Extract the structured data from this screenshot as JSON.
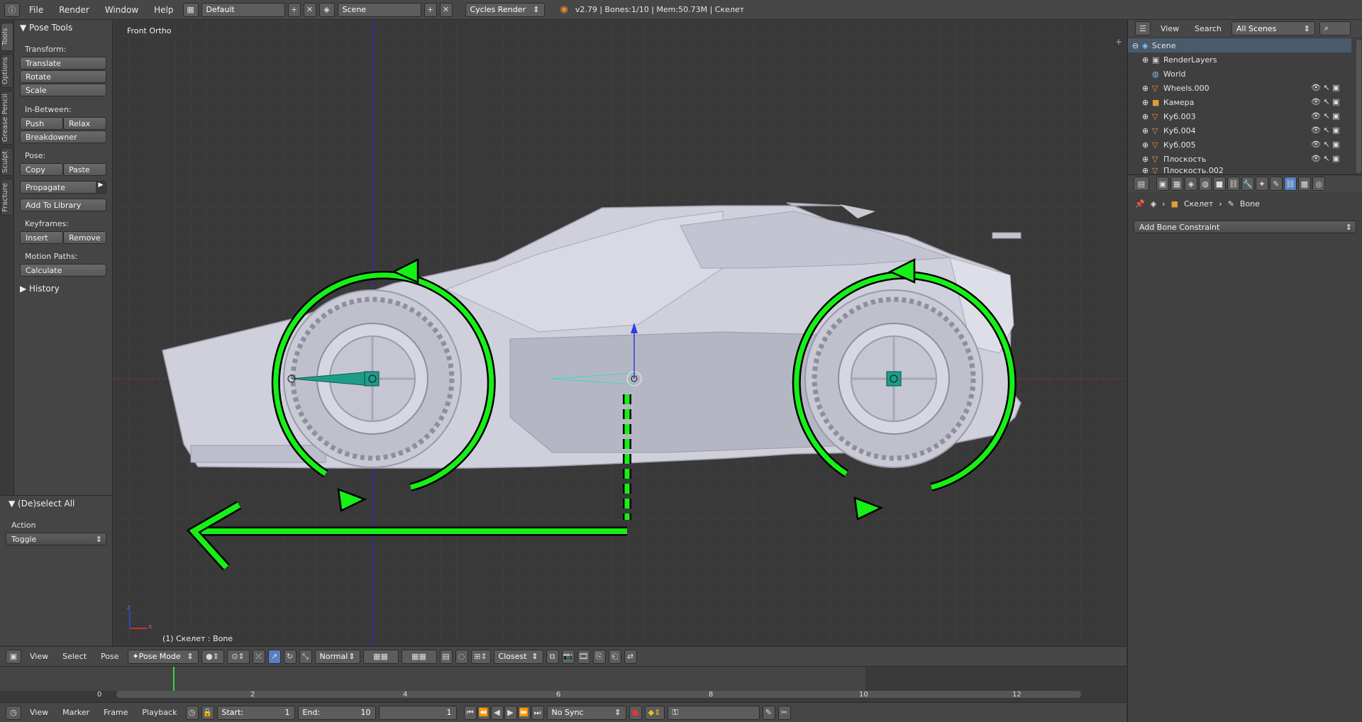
{
  "topbar": {
    "menus": [
      "File",
      "Render",
      "Window",
      "Help"
    ],
    "layout": "Default",
    "scene": "Scene",
    "engine": "Cycles Render",
    "status": "v2.79 | Bones:1/10 | Mem:50.73M | Скелет"
  },
  "side_tabs": [
    "Tools",
    "Options",
    "Grease Pencil",
    "Sculpt",
    "Fracture"
  ],
  "tool_panel": {
    "title": "Pose Tools",
    "transform_label": "Transform:",
    "translate": "Translate",
    "rotate": "Rotate",
    "scale": "Scale",
    "inbetween_label": "In-Between:",
    "push": "Push",
    "relax": "Relax",
    "breakdowner": "Breakdowner",
    "pose_label": "Pose:",
    "copy": "Copy",
    "paste": "Paste",
    "propagate": "Propagate",
    "add_to_library": "Add To Library",
    "keyframes_label": "Keyframes:",
    "insert": "Insert",
    "remove": "Remove",
    "motion_paths_label": "Motion Paths:",
    "calculate": "Calculate",
    "history": "History"
  },
  "operator_panel": {
    "title": "(De)select All",
    "action_label": "Action",
    "action_value": "Toggle"
  },
  "viewport": {
    "view_name": "Front Ortho",
    "object_info": "(1) Скелет : Bone",
    "axis_z": "z",
    "axis_x": "x"
  },
  "outliner": {
    "view": "View",
    "search": "Search",
    "filter": "All Scenes",
    "items": [
      "Scene",
      "RenderLayers",
      "World",
      "Wheels.000",
      "Камера",
      "Куб.003",
      "Куб.004",
      "Куб.005",
      "Плоскость",
      "Плоскость.002"
    ]
  },
  "properties": {
    "breadcrumb_object": "Скелет",
    "breadcrumb_bone": "Bone",
    "add_constraint": "Add Bone Constraint"
  },
  "viewport_header": {
    "view": "View",
    "select": "Select",
    "pose": "Pose",
    "mode": "Pose Mode",
    "orientation": "Normal",
    "snap": "Closest"
  },
  "timeline": {
    "ticks": [
      "0",
      "2",
      "4",
      "6",
      "8",
      "10",
      "12"
    ],
    "view": "View",
    "marker": "Marker",
    "frame": "Frame",
    "playback": "Playback",
    "start_label": "Start:",
    "start_value": "1",
    "end_label": "End:",
    "end_value": "10",
    "current_frame": "1",
    "sync": "No Sync"
  },
  "colors": {
    "accent_green": "#16f016",
    "bone_teal": "#1e9c8a",
    "panel": "#454545",
    "viewport_bg": "#393939"
  }
}
